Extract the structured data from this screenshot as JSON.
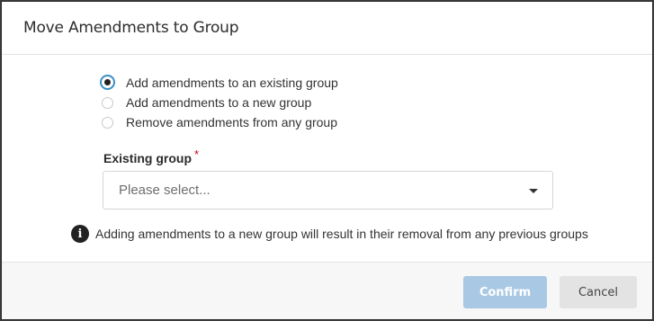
{
  "dialog": {
    "title": "Move Amendments to Group"
  },
  "options": [
    {
      "label": "Add amendments to an existing group",
      "checked": true
    },
    {
      "label": "Add amendments to a new group",
      "checked": false
    },
    {
      "label": "Remove amendments from any group",
      "checked": false
    }
  ],
  "existing_group": {
    "label": "Existing group",
    "required_marker": "*",
    "placeholder": "Please select..."
  },
  "info": {
    "icon": "info-icon",
    "icon_glyph": "i",
    "text": "Adding amendments to a new group will result in their removal from any previous groups"
  },
  "footer": {
    "confirm_label": "Confirm",
    "cancel_label": "Cancel"
  },
  "colors": {
    "confirm_disabled_bg": "#a9c8e4",
    "radio_checked_ring": "#3a8fc3",
    "required_red": "#d0021b"
  }
}
